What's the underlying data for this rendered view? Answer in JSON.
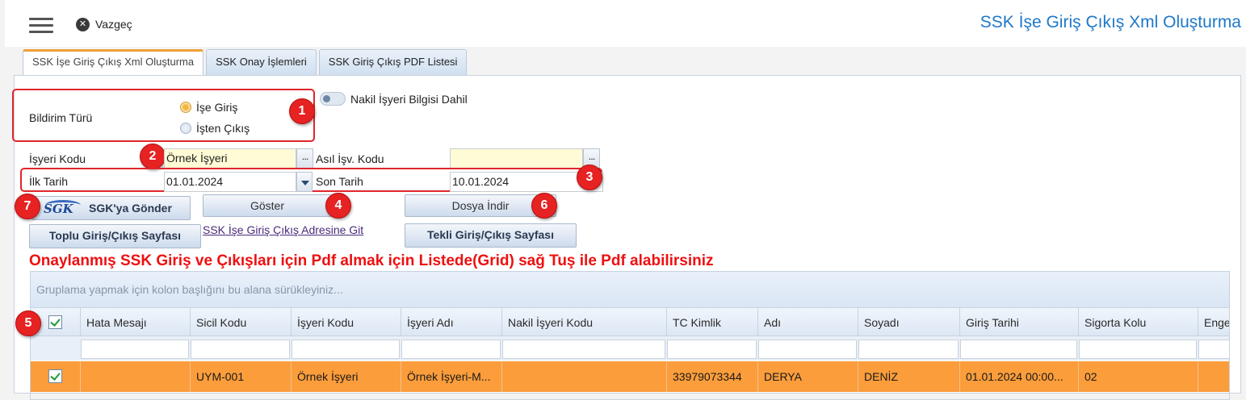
{
  "header": {
    "cancel_label": "Vazgeç",
    "app_title": "SSK İşe Giriş Çıkış Xml Oluşturma"
  },
  "tabs": [
    {
      "label": "SSK İşe Giriş Çıkış Xml Oluşturma",
      "active": true
    },
    {
      "label": "SSK Onay İşlemleri",
      "active": false
    },
    {
      "label": "SSK Giriş Çıkış PDF Listesi",
      "active": false
    }
  ],
  "form": {
    "bildirim_turu_label": "Bildirim Türü",
    "radio_options": [
      {
        "label": "İşe Giriş",
        "checked": true
      },
      {
        "label": "İşten Çıkış",
        "checked": false
      }
    ],
    "nakil_toggle_label": "Nakil İşyeri Bilgisi Dahil",
    "isyeri_kodu_label": "İşyeri Kodu",
    "isyeri_kodu_value": "Örnek İşyeri",
    "asil_isv_kodu_label": "Asıl İşv. Kodu",
    "asil_isv_kodu_value": "",
    "ilk_tarih_label": "İlk Tarih",
    "ilk_tarih_value": "01.01.2024",
    "son_tarih_label": "Son Tarih",
    "son_tarih_value": "10.01.2024",
    "dots_symbol": "..."
  },
  "buttons": {
    "sgk_logo_text": "SGK",
    "sgk_gonder": "SGK'ya Gönder",
    "goster": "Göster",
    "dosya_indir": "Dosya İndir",
    "toplu_sayfa": "Toplu Giriş/Çıkış Sayfası",
    "tekli_sayfa": "Tekli Giriş/Çıkış Sayfası",
    "adres_link": "SSK İşe Giriş Çıkış Adresine Git"
  },
  "badges": [
    "1",
    "2",
    "3",
    "4",
    "5",
    "6",
    "7"
  ],
  "warning_text": "Onaylanmış SSK Giriş ve Çıkışları için Pdf almak için Listede(Grid) sağ Tuş ile Pdf alabilirsiniz",
  "grid": {
    "group_placeholder": "Gruplama yapmak için kolon başlığını bu alana sürükleyiniz...",
    "columns": [
      "Hata Mesajı",
      "Sicil Kodu",
      "İşyeri Kodu",
      "İşyeri Adı",
      "Nakil İşyeri Kodu",
      "TC Kimlik",
      "Adı",
      "Soyadı",
      "Giriş Tarihi",
      "Sigorta Kolu",
      "Enge"
    ],
    "rows": [
      [
        "",
        "UYM-001",
        "Örnek İşyeri",
        "Örnek İşyeri-M...",
        "",
        "33979073344",
        "DERYA",
        "DENİZ",
        "01.01.2024 00:00...",
        "02",
        ""
      ]
    ]
  },
  "colors": {
    "accent_blue": "#1e78c8",
    "badge_red": "#e62222",
    "selected_row": "#fb9d3b",
    "tab_active_border": "#f0a038"
  }
}
